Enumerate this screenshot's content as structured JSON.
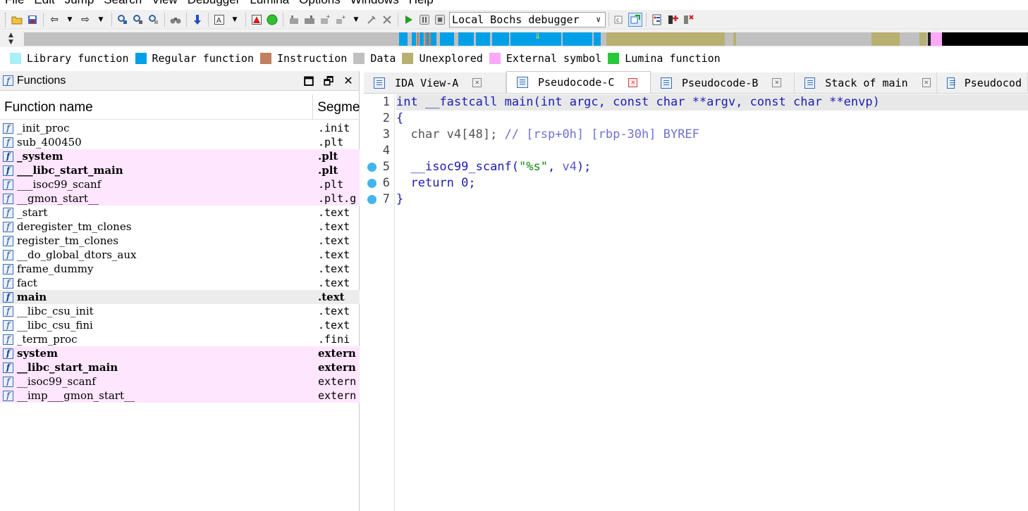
{
  "menu": [
    "File",
    "Edit",
    "Jump",
    "Search",
    "View",
    "Debugger",
    "Lumina",
    "Options",
    "Windows",
    "Help"
  ],
  "toolbar": {
    "debugger_select": "Local Bochs debugger"
  },
  "colors": {
    "library": "#a8f0f8",
    "regular": "#00a0e8",
    "instruction": "#c08060",
    "data": "#c0c0c0",
    "unexplored": "#b8b070",
    "external": "#ffa8f8",
    "lumina": "#28c838",
    "extern_row": "#ffe6ff"
  },
  "legend": [
    {
      "label": "Library function",
      "color": "#a8f0f8"
    },
    {
      "label": "Regular function",
      "color": "#00a0e8"
    },
    {
      "label": "Instruction",
      "color": "#c08060"
    },
    {
      "label": "Data",
      "color": "#c0c0c0"
    },
    {
      "label": "Unexplored",
      "color": "#b8b070"
    },
    {
      "label": "External symbol",
      "color": "#ffa8f8"
    },
    {
      "label": "Lumina function",
      "color": "#28c838"
    }
  ],
  "functions_pane": {
    "title": "Functions",
    "col_name": "Function name",
    "col_segment": "Segme",
    "rows": [
      {
        "name": "_init_proc",
        "segment": ".init",
        "kind": "normal"
      },
      {
        "name": "sub_400450",
        "segment": ".plt",
        "kind": "normal"
      },
      {
        "name": "_system",
        "segment": ".plt",
        "kind": "ext-bold"
      },
      {
        "name": "___libc_start_main",
        "segment": ".plt",
        "kind": "ext-bold"
      },
      {
        "name": "___isoc99_scanf",
        "segment": ".plt",
        "kind": "ext"
      },
      {
        "name": "__gmon_start__",
        "segment": ".plt.go",
        "kind": "ext"
      },
      {
        "name": "_start",
        "segment": ".text",
        "kind": "normal"
      },
      {
        "name": "deregister_tm_clones",
        "segment": ".text",
        "kind": "normal"
      },
      {
        "name": "register_tm_clones",
        "segment": ".text",
        "kind": "normal"
      },
      {
        "name": "__do_global_dtors_aux",
        "segment": ".text",
        "kind": "normal"
      },
      {
        "name": "frame_dummy",
        "segment": ".text",
        "kind": "normal"
      },
      {
        "name": "fact",
        "segment": ".text",
        "kind": "normal"
      },
      {
        "name": "main",
        "segment": ".text",
        "kind": "selected"
      },
      {
        "name": "__libc_csu_init",
        "segment": ".text",
        "kind": "normal"
      },
      {
        "name": "__libc_csu_fini",
        "segment": ".text",
        "kind": "normal"
      },
      {
        "name": "_term_proc",
        "segment": ".fini",
        "kind": "normal"
      },
      {
        "name": "system",
        "segment": "extern",
        "kind": "ext-bold"
      },
      {
        "name": "__libc_start_main",
        "segment": "extern",
        "kind": "ext-bold"
      },
      {
        "name": "__isoc99_scanf",
        "segment": "extern",
        "kind": "ext"
      },
      {
        "name": "__imp___gmon_start__",
        "segment": "extern",
        "kind": "ext"
      }
    ]
  },
  "tabs": [
    {
      "label": "IDA View-A",
      "active": false
    },
    {
      "label": "Pseudocode-C",
      "active": true
    },
    {
      "label": "Pseudocode-B",
      "active": false
    },
    {
      "label": "Stack of main",
      "active": false
    },
    {
      "label": "Pseudocod",
      "active": false
    }
  ],
  "code": {
    "line_numbers": [
      "1",
      "2",
      "3",
      "4",
      "5",
      "6",
      "7"
    ],
    "l1": {
      "ret": "int",
      "cc": "__fastcall",
      "fn": "main",
      "args": "(int argc, const char **argv, const char **envp)"
    },
    "l2": "{",
    "l3": {
      "decl": "char v4[48];",
      "comment": "// [rsp+0h] [rbp-30h] BYREF"
    },
    "l5": {
      "call": "__isoc99_scanf(",
      "str": "\"%s\"",
      "sep": ", ",
      "arg": "v4",
      "end": ");"
    },
    "l6": "return 0;",
    "l7": "}"
  }
}
